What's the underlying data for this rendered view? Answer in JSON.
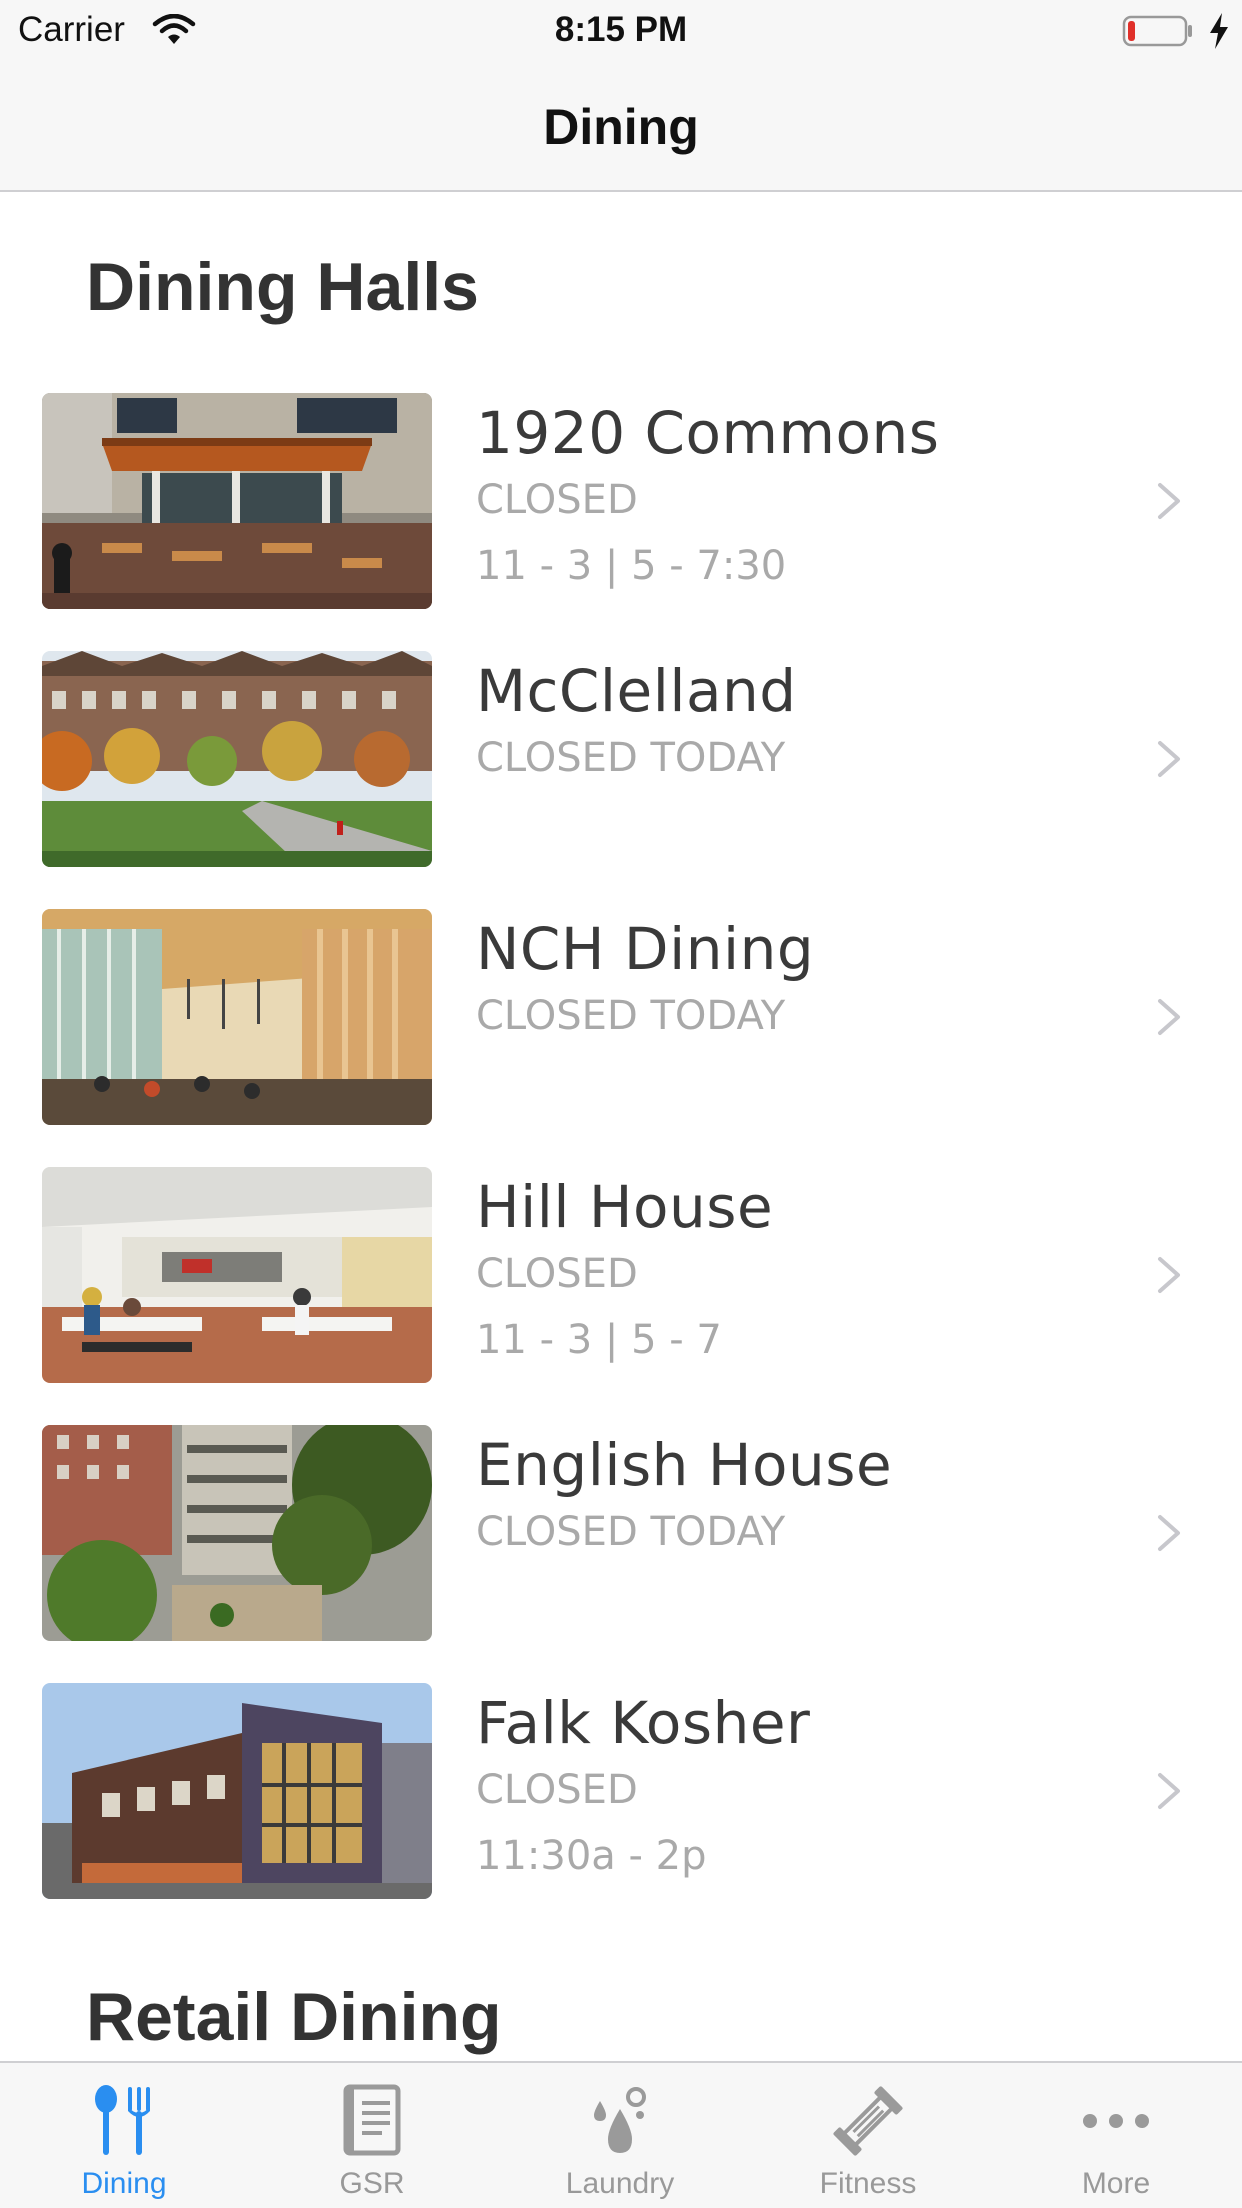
{
  "status_bar": {
    "carrier": "Carrier",
    "time": "8:15 PM"
  },
  "nav": {
    "title": "Dining"
  },
  "sections": {
    "dining_halls": "Dining Halls",
    "retail": "Retail Dining"
  },
  "halls": [
    {
      "name": "1920 Commons",
      "status": "CLOSED",
      "hours": "11 - 3  |  5 - 7:30"
    },
    {
      "name": "McClelland",
      "status": "CLOSED TODAY",
      "hours": ""
    },
    {
      "name": "NCH Dining",
      "status": "CLOSED TODAY",
      "hours": ""
    },
    {
      "name": "Hill House",
      "status": "CLOSED",
      "hours": "11 - 3  |  5 - 7"
    },
    {
      "name": "English House",
      "status": "CLOSED TODAY",
      "hours": ""
    },
    {
      "name": "Falk Kosher",
      "status": "CLOSED",
      "hours": "11:30a - 2p"
    }
  ],
  "tabs": [
    {
      "label": "Dining",
      "icon": "fork-spoon-icon"
    },
    {
      "label": "GSR",
      "icon": "book-icon"
    },
    {
      "label": "Laundry",
      "icon": "water-drops-icon"
    },
    {
      "label": "Fitness",
      "icon": "dumbbell-icon"
    },
    {
      "label": "More",
      "icon": "more-dots-icon"
    }
  ],
  "colors": {
    "accent": "#2a8ef0",
    "inactive": "#999999",
    "muted_text": "#a9a9a9",
    "battery_low": "#e0302a"
  }
}
